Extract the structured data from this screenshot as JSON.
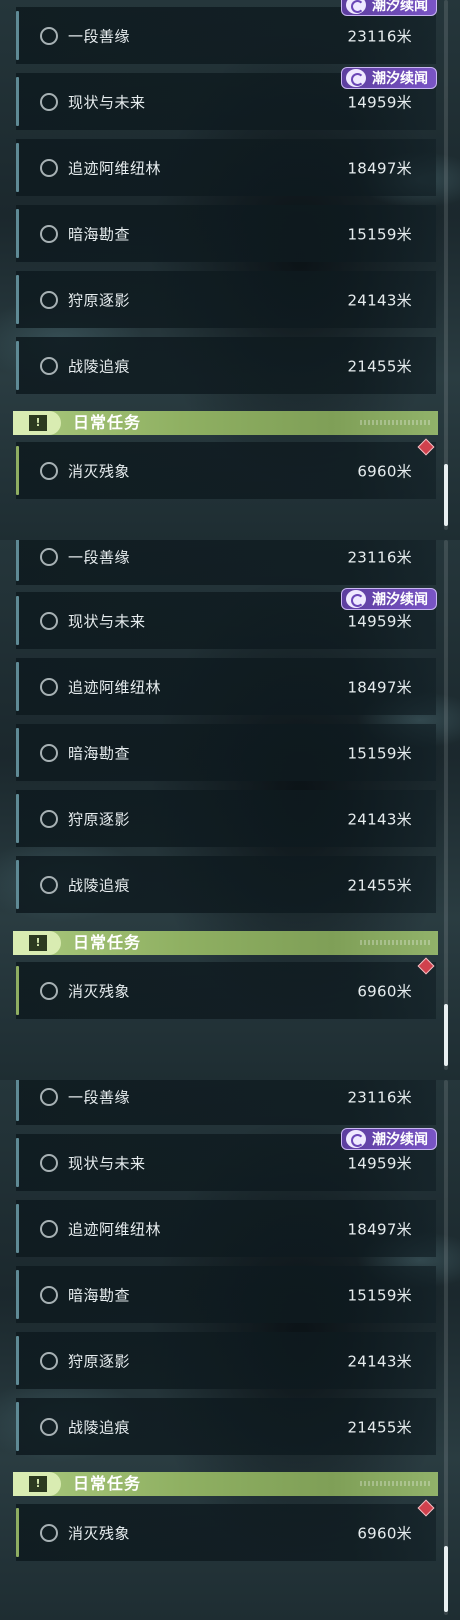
{
  "quests": [
    {
      "name": "一段善缘",
      "distance": "23116米"
    },
    {
      "name": "现状与未来",
      "distance": "14959米"
    },
    {
      "name": "追迹阿维纽林",
      "distance": "18497米"
    },
    {
      "name": "暗海勘查",
      "distance": "15159米"
    },
    {
      "name": "狩原逐影",
      "distance": "24143米"
    },
    {
      "name": "战陵追痕",
      "distance": "21455米"
    }
  ],
  "badge": {
    "label": "潮汐续闻",
    "icon": "tide-event-icon",
    "color": "#6b47b7"
  },
  "daily_section": {
    "title": "日常任务",
    "icon": "exclamation-icon",
    "color": "#8fb062"
  },
  "daily_quest": {
    "name": "消灭残象",
    "distance": "6960米",
    "alert_icon": "red-diamond-alert-icon"
  }
}
